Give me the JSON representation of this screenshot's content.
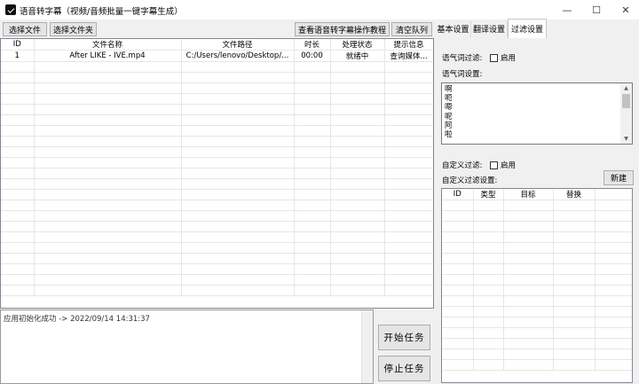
{
  "window": {
    "title": "语音转字幕（视频/音频批量一键字幕生成）",
    "minimize_glyph": "—",
    "maximize_glyph": "☐",
    "close_glyph": "✕"
  },
  "toolbar": {
    "select_file": "选择文件",
    "select_folder": "选择文件夹",
    "tutorial": "查看语音转字幕操作教程",
    "clear_queue": "清空队列"
  },
  "tabs": [
    {
      "label": "基本设置",
      "active": false
    },
    {
      "label": "翻译设置",
      "active": false
    },
    {
      "label": "过滤设置",
      "active": true
    }
  ],
  "file_table": {
    "columns": [
      "ID",
      "文件名称",
      "文件路径",
      "时长",
      "处理状态",
      "提示信息"
    ],
    "rows": [
      [
        "1",
        "After LIKE - IVE.mp4",
        "C:/Users/lenovo/Desktop/...",
        "00:00",
        "就绪中",
        "查询媒体..."
      ]
    ]
  },
  "log": {
    "text": "应用初始化成功  ->  2022/09/14 14:31:37"
  },
  "actions": {
    "start": "开始任务",
    "stop": "停止任务"
  },
  "filter": {
    "modal_filter_label": "语气词过滤:",
    "modal_enable_label": "启用",
    "modal_settings_label": "语气词设置:",
    "modal_words": [
      "啊",
      "呃",
      "嗯",
      "呢",
      "阿",
      "啦"
    ],
    "custom_filter_label": "自定义过滤:",
    "custom_enable_label": "启用",
    "custom_settings_label": "自定义过滤设置:",
    "new_button": "新建",
    "custom_columns": [
      "ID",
      "类型",
      "目标",
      "替换"
    ]
  },
  "icons": {
    "app": "app-logo-icon",
    "scroll_up": "▲",
    "scroll_down": "▼"
  }
}
